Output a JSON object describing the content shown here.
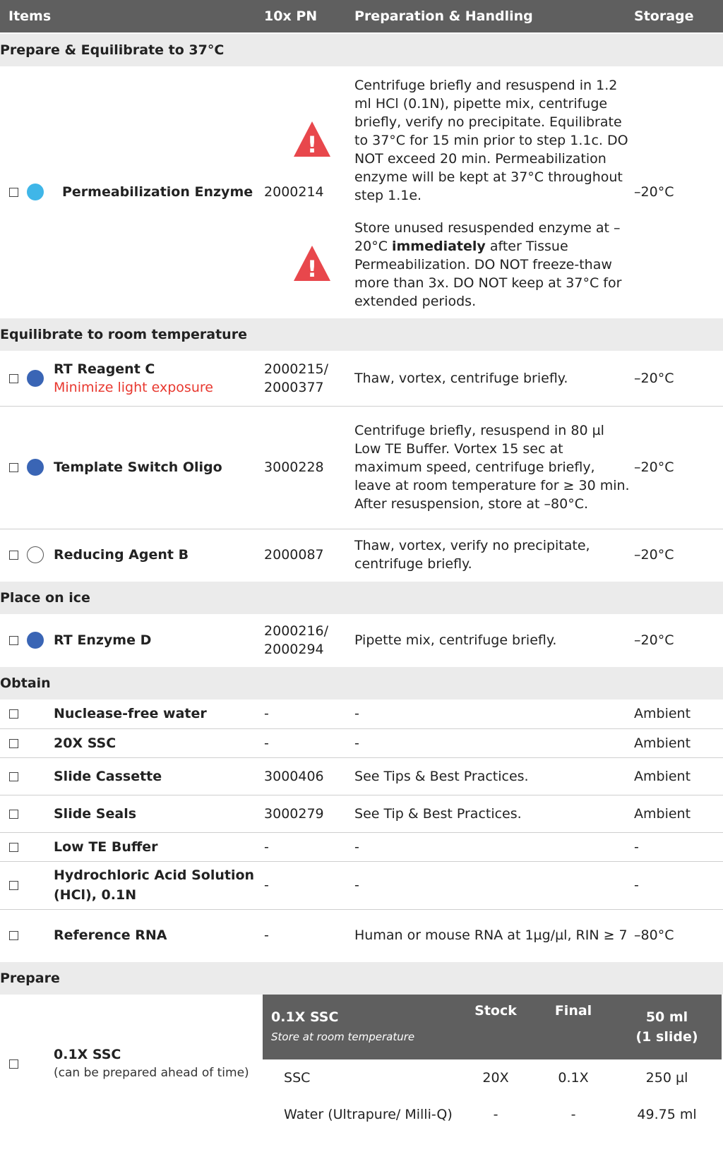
{
  "header": {
    "items": "Items",
    "pn": "10x PN",
    "prep": "Preparation & Handling",
    "storage": "Storage"
  },
  "sections": {
    "s1": "Prepare & Equilibrate to 37°C",
    "s2": "Equilibrate to room temperature",
    "s3": "Place on ice",
    "s4": "Obtain",
    "s5": "Prepare"
  },
  "rows": {
    "perm": {
      "name": "Permeabilization Enzyme",
      "pn": "2000214",
      "storage": "–20°C",
      "note1": "Centrifuge briefly and resuspend in 1.2 ml HCl (0.1N), pipette mix, centrifuge briefly, verify no precipitate. Equilibrate to 37°C for 15 min prior to step 1.1c. DO NOT exceed 20 min. Permeabilization enzyme will be kept at 37°C throughout step 1.1e.",
      "note2a": "Store unused resuspended enzyme at –20°C ",
      "note2b": "immediately",
      "note2c": " after Tissue Permeabilization.  DO NOT freeze-thaw more than 3x. DO NOT keep at 37°C for extended periods.",
      "warn_glyph": "!"
    },
    "rtc": {
      "name": "RT Reagent C",
      "sub": "Minimize light exposure",
      "pn1": "2000215/",
      "pn2": "2000377",
      "prep": "Thaw, vortex, centrifuge briefly.",
      "storage": "–20°C"
    },
    "tso": {
      "name": "Template Switch Oligo",
      "pn": "3000228",
      "prep": "Centrifuge briefly, resuspend in 80 µl Low TE Buffer. Vortex 15 sec at maximum speed, centrifuge briefly, leave at room temperature for ≥ 30 min. After resuspension, store at –80°C.",
      "storage": "–20°C"
    },
    "rab": {
      "name": "Reducing Agent B",
      "pn": "2000087",
      "prep": "Thaw, vortex, verify no precipitate, centrifuge briefly.",
      "storage": "–20°C"
    },
    "rtd": {
      "name": "RT Enzyme D",
      "pn1": "2000216/",
      "pn2": "2000294",
      "prep": "Pipette mix, centrifuge briefly.",
      "storage": "–20°C"
    },
    "water": {
      "name": "Nuclease-free water",
      "pn": "-",
      "prep": "-",
      "storage": "Ambient"
    },
    "ssc20": {
      "name": "20X SSC",
      "pn": "-",
      "prep": "-",
      "storage": "Ambient"
    },
    "cass": {
      "name": "Slide Cassette",
      "pn": "3000406",
      "prep": "See Tips & Best Practices.",
      "storage": "Ambient"
    },
    "seals": {
      "name": "Slide Seals",
      "pn": "3000279",
      "prep": "See Tip & Best Practices.",
      "storage": "Ambient"
    },
    "lowte": {
      "name": "Low TE Buffer",
      "pn": "-",
      "prep": "-",
      "storage": "-"
    },
    "hcl": {
      "name1": "Hydrochloric Acid Solution",
      "name2": "(HCl), 0.1N",
      "pn": "-",
      "prep": "-",
      "storage": "-"
    },
    "ref": {
      "name": "Reference RNA",
      "pn": "-",
      "prep": "Human or mouse RNA at  1µg/µl, RIN ≥ 7",
      "storage": "–80°C"
    },
    "ssc01": {
      "name": "0.1X SSC",
      "sub": "(can be prepared ahead of time)"
    }
  },
  "recipe": {
    "title": "0.1X SSC",
    "subtitle": "Store at room temperature",
    "col_stock": "Stock",
    "col_final": "Final",
    "col_vol1": "50 ml",
    "col_vol2": "(1 slide)",
    "r1": {
      "name": "SSC",
      "stock": "20X",
      "final": "0.1X",
      "vol": "250 µl"
    },
    "r2": {
      "name": "Water",
      "name_sub": " (Ultrapure/ Milli-Q)",
      "stock": "-",
      "final": "-",
      "vol": "49.75 ml"
    }
  },
  "colors": {
    "header_bg": "#5f5f5f",
    "section_bg": "#ebebeb",
    "warn_red": "#e8474c",
    "dot_light": "#3fb6e8",
    "dot_blue": "#3a65b5",
    "text_red": "#e8382f"
  }
}
